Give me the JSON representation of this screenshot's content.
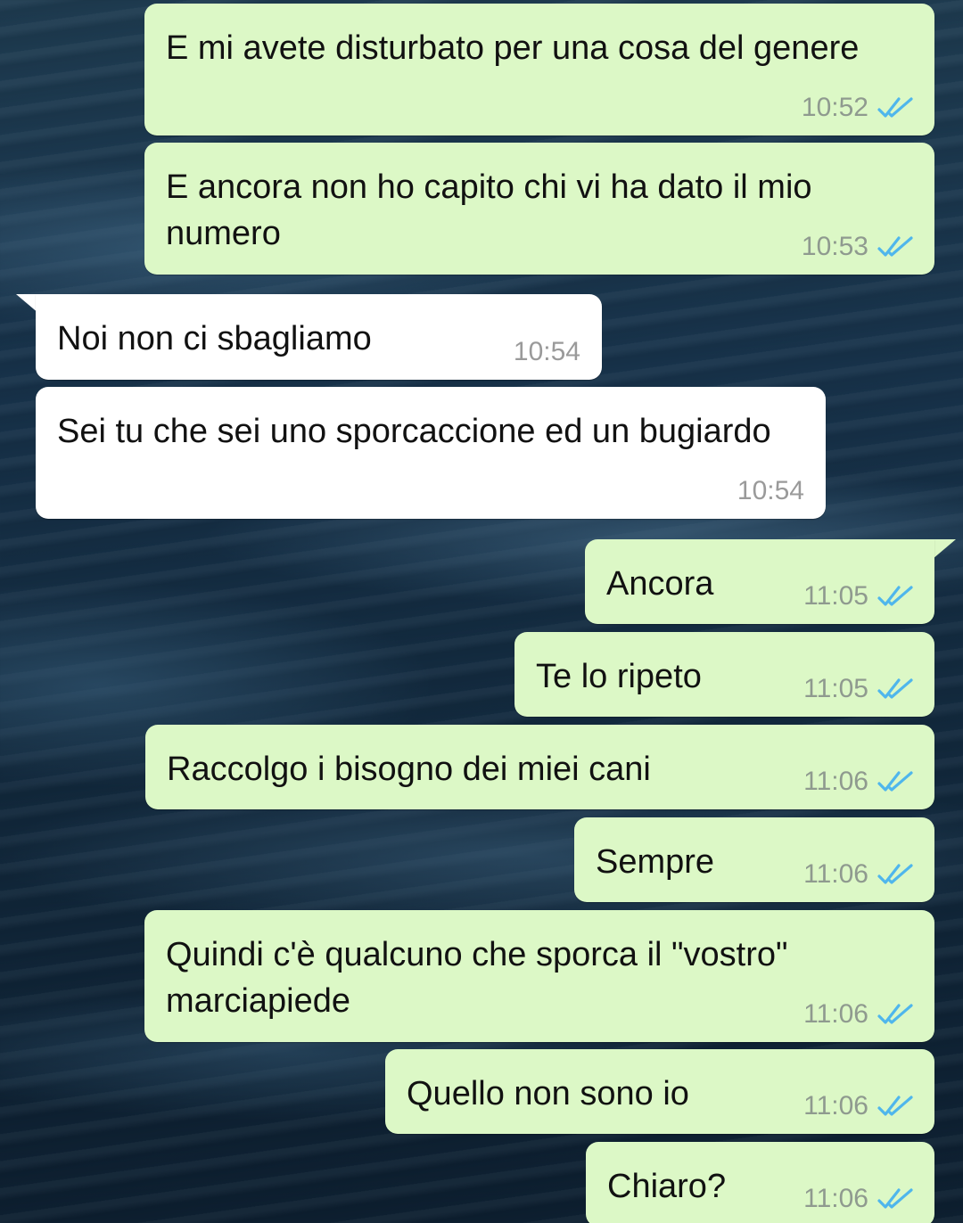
{
  "messages": [
    {
      "dir": "out",
      "text": "E mi avete disturbato per una cosa del genere",
      "time": "10:52",
      "status_icon": "double-check-read-icon"
    },
    {
      "dir": "out",
      "text": "E ancora non ho capito chi vi ha dato il mio numero",
      "time": "10:53",
      "status_icon": "double-check-read-icon"
    },
    {
      "dir": "in",
      "text": "Noi non ci sbagliamo",
      "time": "10:54"
    },
    {
      "dir": "in",
      "text": "Sei tu che sei uno sporcaccione ed un bugiardo",
      "time": "10:54"
    },
    {
      "dir": "out",
      "text": "Ancora",
      "time": "11:05",
      "status_icon": "double-check-read-icon"
    },
    {
      "dir": "out",
      "text": "Te lo ripeto",
      "time": "11:05",
      "status_icon": "double-check-read-icon"
    },
    {
      "dir": "out",
      "text": "Raccolgo i bisogno dei miei cani",
      "time": "11:06",
      "status_icon": "double-check-read-icon"
    },
    {
      "dir": "out",
      "text": "Sempre",
      "time": "11:06",
      "status_icon": "double-check-read-icon"
    },
    {
      "dir": "out",
      "text": "Quindi c'è qualcuno che sporca il \"vostro\" marciapiede",
      "time": "11:06",
      "status_icon": "double-check-read-icon"
    },
    {
      "dir": "out",
      "text": "Quello non sono io",
      "time": "11:06",
      "status_icon": "double-check-read-icon"
    },
    {
      "dir": "out",
      "text": "Chiaro?",
      "time": "11:06",
      "status_icon": "double-check-read-icon"
    }
  ],
  "colors": {
    "outgoing_bubble": "#dcf8c6",
    "incoming_bubble": "#ffffff",
    "read_ticks": "#4fb6ec",
    "timestamp": "#8f9a8f"
  }
}
